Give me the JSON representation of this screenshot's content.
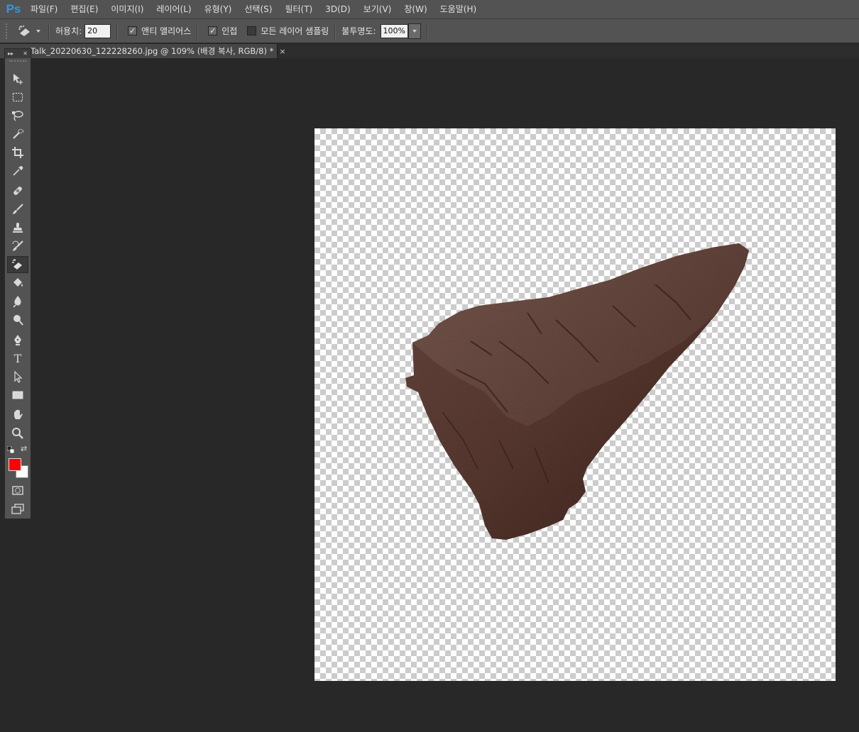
{
  "app": {
    "logo": "Ps"
  },
  "menu": [
    {
      "label": "파일(F)"
    },
    {
      "label": "편집(E)"
    },
    {
      "label": "이미지(I)"
    },
    {
      "label": "레이어(L)"
    },
    {
      "label": "유형(Y)"
    },
    {
      "label": "선택(S)"
    },
    {
      "label": "필터(T)"
    },
    {
      "label": "3D(D)"
    },
    {
      "label": "보기(V)"
    },
    {
      "label": "창(W)"
    },
    {
      "label": "도움말(H)"
    }
  ],
  "options": {
    "tool_icon": "magic-eraser-icon",
    "tolerance_label": "허용치:",
    "tolerance_value": "20",
    "antialias_label": "앤티 앨리어스",
    "antialias_checked": true,
    "contiguous_label": "인접",
    "contiguous_checked": true,
    "sample_all_label": "모든 레이어 샘플링",
    "sample_all_checked": false,
    "opacity_label": "불투명도:",
    "opacity_value": "100%"
  },
  "document": {
    "tab_title": "Talk_20220630_122228260.jpg @ 109% (배경 복사, RGB/8) *",
    "close_symbol": "×"
  },
  "toolbox": {
    "tools": [
      {
        "name": "move-tool",
        "icon": "move-icon"
      },
      {
        "name": "marquee-tool",
        "icon": "rect-marquee-icon"
      },
      {
        "name": "lasso-tool",
        "icon": "lasso-icon"
      },
      {
        "name": "quick-selection-tool",
        "icon": "quick-selection-icon"
      },
      {
        "name": "crop-tool",
        "icon": "crop-icon"
      },
      {
        "name": "eyedropper-tool",
        "icon": "eyedropper-icon"
      },
      {
        "name": "healing-brush-tool",
        "icon": "bandage-icon"
      },
      {
        "name": "brush-tool",
        "icon": "brush-icon"
      },
      {
        "name": "clone-stamp-tool",
        "icon": "stamp-icon"
      },
      {
        "name": "history-brush-tool",
        "icon": "history-brush-icon"
      },
      {
        "name": "eraser-tool",
        "icon": "magic-eraser-icon",
        "active": true
      },
      {
        "name": "paint-bucket-tool",
        "icon": "bucket-icon"
      },
      {
        "name": "blur-tool",
        "icon": "blur-icon"
      },
      {
        "name": "dodge-tool",
        "icon": "dodge-icon"
      },
      {
        "name": "pen-tool",
        "icon": "pen-icon"
      },
      {
        "name": "type-tool",
        "icon": "type-icon",
        "text": "T"
      },
      {
        "name": "path-selection-tool",
        "icon": "arrow-icon"
      },
      {
        "name": "shape-tool",
        "icon": "rectangle-icon"
      },
      {
        "name": "hand-tool",
        "icon": "hand-icon"
      },
      {
        "name": "zoom-tool",
        "icon": "zoom-icon"
      }
    ],
    "foreground_color": "#ff0000",
    "background_color": "#ffffff"
  }
}
